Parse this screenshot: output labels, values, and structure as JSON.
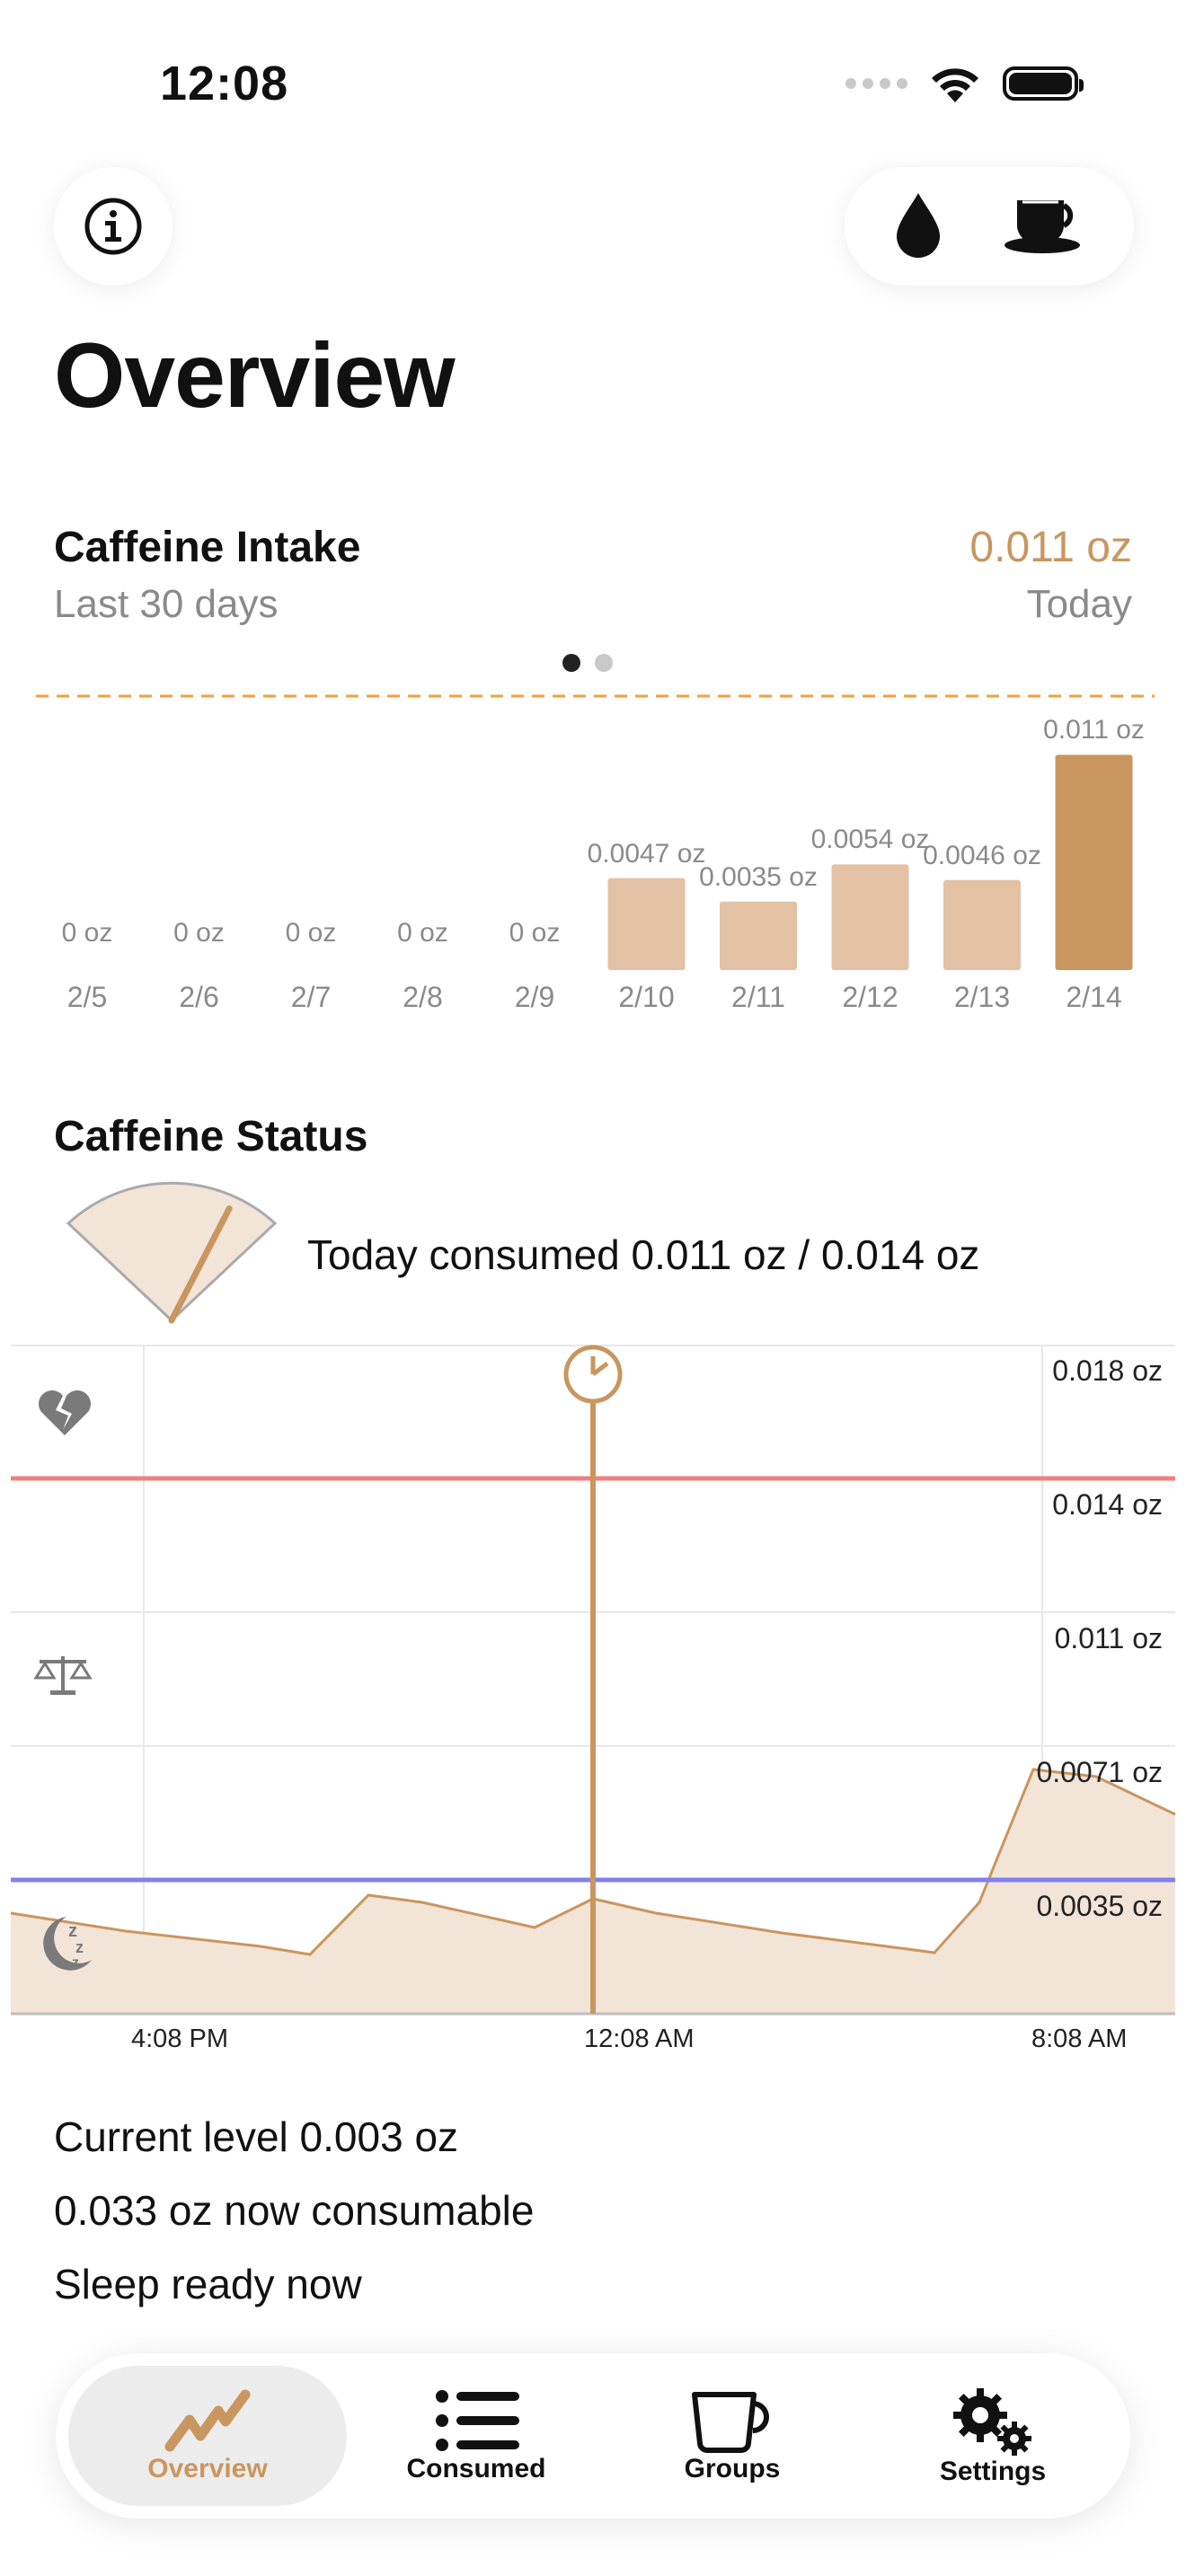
{
  "status_bar": {
    "time": "12:08"
  },
  "header": {
    "title": "Overview",
    "info_icon": "info-icon",
    "water_icon": "water-drop-icon",
    "coffee_icon": "coffee-cup-icon"
  },
  "intake_card": {
    "title": "Caffeine Intake",
    "subtitle": "Last 30 days",
    "today_value": "0.011 oz",
    "today_label": "Today"
  },
  "chart_data": {
    "type": "bar",
    "categories": [
      "2/5",
      "2/6",
      "2/7",
      "2/8",
      "2/9",
      "2/10",
      "2/11",
      "2/12",
      "2/13",
      "2/14"
    ],
    "values": [
      0,
      0,
      0,
      0,
      0,
      0.0047,
      0.0035,
      0.0054,
      0.0046,
      0.011
    ],
    "value_labels": [
      "0 oz",
      "0 oz",
      "0 oz",
      "0 oz",
      "0 oz",
      "0.0047 oz",
      "0.0035 oz",
      "0.0054 oz",
      "0.0046 oz",
      "0.011 oz"
    ],
    "highlight_index": 9,
    "limit_line": 0.014,
    "ylim": [
      0,
      0.014
    ],
    "colors": {
      "bar": "#e2c1a4",
      "bar_today": "#c9965f",
      "limit": "#f0a040"
    }
  },
  "status_card": {
    "title": "Caffeine Status",
    "gauge_fraction": 0.79,
    "today_consumed": "Today consumed 0.011 oz / 0.014 oz"
  },
  "status_chart": {
    "type": "area",
    "y_ticks": [
      "0.018 oz",
      "0.014 oz",
      "0.011 oz",
      "0.0071 oz",
      "0.0035 oz"
    ],
    "x_ticks": [
      "4:08 PM",
      "12:08 AM",
      "8:08 AM"
    ],
    "limit_line": 0.014,
    "sleep_line": 0.0035,
    "current_time": "12:08 AM",
    "icons": [
      "broken-heart-icon",
      "balance-scale-icon",
      "sleep-moon-icon",
      "clock-icon"
    ],
    "colors": {
      "limit": "#f08080",
      "sleep": "#8080f0",
      "curve": "#c9965f",
      "fill": "#f3e4d8"
    }
  },
  "levels": {
    "current": "Current level 0.003 oz",
    "consumable": "0.033 oz now consumable",
    "sleep": "Sleep ready now"
  },
  "tabbar": {
    "tabs": [
      {
        "label": "Overview",
        "icon": "chart-icon"
      },
      {
        "label": "Consumed",
        "icon": "list-icon"
      },
      {
        "label": "Groups",
        "icon": "cup-icon"
      },
      {
        "label": "Settings",
        "icon": "gears-icon"
      }
    ]
  }
}
